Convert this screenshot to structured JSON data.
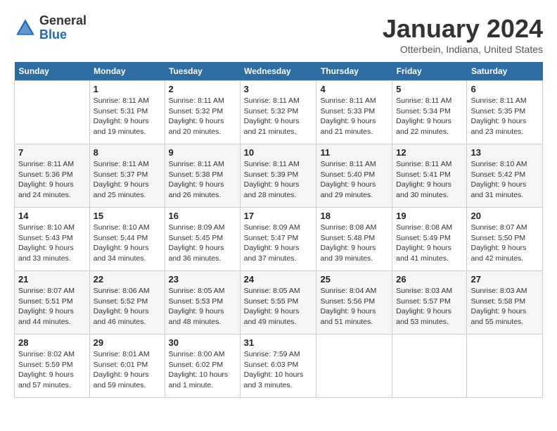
{
  "header": {
    "logo_general": "General",
    "logo_blue": "Blue",
    "month_title": "January 2024",
    "subtitle": "Otterbein, Indiana, United States"
  },
  "days_of_week": [
    "Sunday",
    "Monday",
    "Tuesday",
    "Wednesday",
    "Thursday",
    "Friday",
    "Saturday"
  ],
  "weeks": [
    [
      {
        "day": "",
        "info": ""
      },
      {
        "day": "1",
        "info": "Sunrise: 8:11 AM\nSunset: 5:31 PM\nDaylight: 9 hours\nand 19 minutes."
      },
      {
        "day": "2",
        "info": "Sunrise: 8:11 AM\nSunset: 5:32 PM\nDaylight: 9 hours\nand 20 minutes."
      },
      {
        "day": "3",
        "info": "Sunrise: 8:11 AM\nSunset: 5:32 PM\nDaylight: 9 hours\nand 21 minutes."
      },
      {
        "day": "4",
        "info": "Sunrise: 8:11 AM\nSunset: 5:33 PM\nDaylight: 9 hours\nand 21 minutes."
      },
      {
        "day": "5",
        "info": "Sunrise: 8:11 AM\nSunset: 5:34 PM\nDaylight: 9 hours\nand 22 minutes."
      },
      {
        "day": "6",
        "info": "Sunrise: 8:11 AM\nSunset: 5:35 PM\nDaylight: 9 hours\nand 23 minutes."
      }
    ],
    [
      {
        "day": "7",
        "info": "Sunrise: 8:11 AM\nSunset: 5:36 PM\nDaylight: 9 hours\nand 24 minutes."
      },
      {
        "day": "8",
        "info": "Sunrise: 8:11 AM\nSunset: 5:37 PM\nDaylight: 9 hours\nand 25 minutes."
      },
      {
        "day": "9",
        "info": "Sunrise: 8:11 AM\nSunset: 5:38 PM\nDaylight: 9 hours\nand 26 minutes."
      },
      {
        "day": "10",
        "info": "Sunrise: 8:11 AM\nSunset: 5:39 PM\nDaylight: 9 hours\nand 28 minutes."
      },
      {
        "day": "11",
        "info": "Sunrise: 8:11 AM\nSunset: 5:40 PM\nDaylight: 9 hours\nand 29 minutes."
      },
      {
        "day": "12",
        "info": "Sunrise: 8:11 AM\nSunset: 5:41 PM\nDaylight: 9 hours\nand 30 minutes."
      },
      {
        "day": "13",
        "info": "Sunrise: 8:10 AM\nSunset: 5:42 PM\nDaylight: 9 hours\nand 31 minutes."
      }
    ],
    [
      {
        "day": "14",
        "info": "Sunrise: 8:10 AM\nSunset: 5:43 PM\nDaylight: 9 hours\nand 33 minutes."
      },
      {
        "day": "15",
        "info": "Sunrise: 8:10 AM\nSunset: 5:44 PM\nDaylight: 9 hours\nand 34 minutes."
      },
      {
        "day": "16",
        "info": "Sunrise: 8:09 AM\nSunset: 5:45 PM\nDaylight: 9 hours\nand 36 minutes."
      },
      {
        "day": "17",
        "info": "Sunrise: 8:09 AM\nSunset: 5:47 PM\nDaylight: 9 hours\nand 37 minutes."
      },
      {
        "day": "18",
        "info": "Sunrise: 8:08 AM\nSunset: 5:48 PM\nDaylight: 9 hours\nand 39 minutes."
      },
      {
        "day": "19",
        "info": "Sunrise: 8:08 AM\nSunset: 5:49 PM\nDaylight: 9 hours\nand 41 minutes."
      },
      {
        "day": "20",
        "info": "Sunrise: 8:07 AM\nSunset: 5:50 PM\nDaylight: 9 hours\nand 42 minutes."
      }
    ],
    [
      {
        "day": "21",
        "info": "Sunrise: 8:07 AM\nSunset: 5:51 PM\nDaylight: 9 hours\nand 44 minutes."
      },
      {
        "day": "22",
        "info": "Sunrise: 8:06 AM\nSunset: 5:52 PM\nDaylight: 9 hours\nand 46 minutes."
      },
      {
        "day": "23",
        "info": "Sunrise: 8:05 AM\nSunset: 5:53 PM\nDaylight: 9 hours\nand 48 minutes."
      },
      {
        "day": "24",
        "info": "Sunrise: 8:05 AM\nSunset: 5:55 PM\nDaylight: 9 hours\nand 49 minutes."
      },
      {
        "day": "25",
        "info": "Sunrise: 8:04 AM\nSunset: 5:56 PM\nDaylight: 9 hours\nand 51 minutes."
      },
      {
        "day": "26",
        "info": "Sunrise: 8:03 AM\nSunset: 5:57 PM\nDaylight: 9 hours\nand 53 minutes."
      },
      {
        "day": "27",
        "info": "Sunrise: 8:03 AM\nSunset: 5:58 PM\nDaylight: 9 hours\nand 55 minutes."
      }
    ],
    [
      {
        "day": "28",
        "info": "Sunrise: 8:02 AM\nSunset: 5:59 PM\nDaylight: 9 hours\nand 57 minutes."
      },
      {
        "day": "29",
        "info": "Sunrise: 8:01 AM\nSunset: 6:01 PM\nDaylight: 9 hours\nand 59 minutes."
      },
      {
        "day": "30",
        "info": "Sunrise: 8:00 AM\nSunset: 6:02 PM\nDaylight: 10 hours\nand 1 minute."
      },
      {
        "day": "31",
        "info": "Sunrise: 7:59 AM\nSunset: 6:03 PM\nDaylight: 10 hours\nand 3 minutes."
      },
      {
        "day": "",
        "info": ""
      },
      {
        "day": "",
        "info": ""
      },
      {
        "day": "",
        "info": ""
      }
    ]
  ]
}
